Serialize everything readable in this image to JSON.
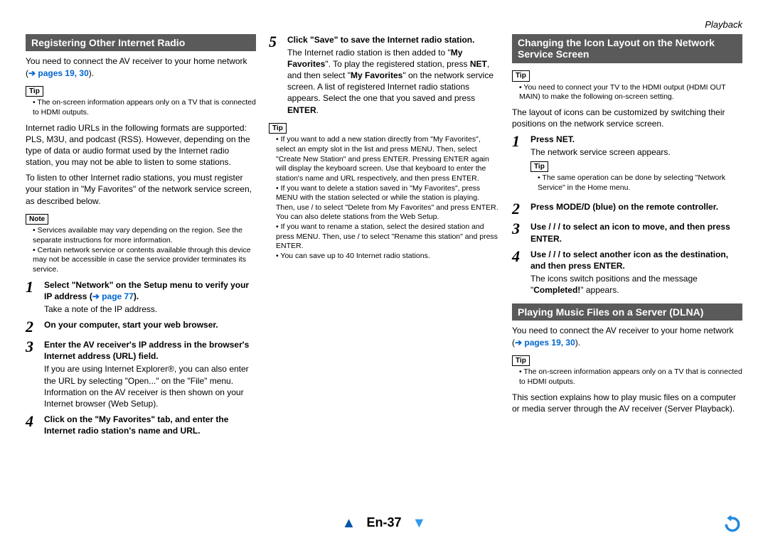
{
  "breadcrumb": "Playback",
  "page_number": "En-37",
  "col1": {
    "heading": "Registering Other Internet Radio",
    "intro_a": "You need to connect the AV receiver to your home network (",
    "intro_link": "➔ pages 19, 30",
    "intro_b": ").",
    "tip_label": "Tip",
    "tip1": "The on-screen information appears only on a TV that is connected to HDMI outputs.",
    "p2": "Internet radio URLs in the following formats are supported: PLS, M3U, and podcast (RSS). However, depending on the type of data or audio format used by the Internet radio station, you may not be able to listen to some stations.",
    "p3": "To listen to other Internet radio stations, you must register your station in \"My Favorites\" of the network service screen, as described below.",
    "note_label": "Note",
    "note1": "Services available may vary depending on the region. See the separate instructions for more information.",
    "note2": "Certain network service or contents available through this device may not be accessible in case the service provider terminates its service.",
    "steps": [
      {
        "n": "1",
        "title_a": "Select \"Network\" on the Setup menu to verify your IP address (",
        "title_link": "➔ page 77",
        "title_b": ").",
        "desc": "Take a note of the IP address."
      },
      {
        "n": "2",
        "title": "On your computer, start your web browser."
      },
      {
        "n": "3",
        "title": "Enter the AV receiver's IP address in the browser's Internet address (URL) field.",
        "desc": "If you are using Internet Explorer®, you can also enter the URL by selecting \"Open...\" on the \"File\" menu.\nInformation on the AV receiver is then shown on your Internet browser (Web Setup)."
      },
      {
        "n": "4",
        "title": "Click on the \"My Favorites\" tab, and enter the Internet radio station's name and URL."
      }
    ]
  },
  "col2": {
    "step5": {
      "n": "5",
      "title": "Click \"Save\" to save the Internet radio station.",
      "desc_a": "The Internet radio station is then added to \"",
      "desc_b": "My Favorites",
      "desc_c": "\". To play the registered station, press ",
      "desc_d": "NET",
      "desc_e": ", and then select \"",
      "desc_f": "My Favorites",
      "desc_g": "\" on the network service screen. A list of registered Internet radio stations appears. Select the one that you saved and press ",
      "desc_h": "ENTER",
      "desc_i": "."
    },
    "tip_label": "Tip",
    "tip_b1": "If you want to add a new station directly from \"My Favorites\", select an empty slot in the list and press MENU. Then, select \"Create New Station\" and press ENTER. Pressing ENTER again will display the keyboard screen. Use that keyboard to enter the station's name and URL respectively, and then press ENTER.",
    "tip_b2": "If you want to delete a station saved in \"My Favorites\", press MENU with the station selected or while the station is playing. Then, use  /  to select \"Delete from My Favorites\" and press ENTER. You can also delete stations from the Web Setup.",
    "tip_b3": "If you want to rename a station, select the desired station and press MENU. Then, use  /  to select \"Rename this station\" and press ENTER.",
    "tip_b4": "You can save up to 40 Internet radio stations."
  },
  "col3": {
    "heading1": "Changing the Icon Layout on the Network Service Screen",
    "tip_label": "Tip",
    "tip1": "You need to connect your TV to the HDMI output (HDMI OUT MAIN) to make the following on-screen setting.",
    "p1": "The layout of icons can be customized by switching their positions on the network service screen.",
    "steps": [
      {
        "n": "1",
        "title": "Press NET.",
        "desc": "The network service screen appears.",
        "tip_label": "Tip",
        "tip": "The same operation can be done by selecting \"Network Service\" in the Home menu."
      },
      {
        "n": "2",
        "title": "Press MODE/D (blue) on the remote controller."
      },
      {
        "n": "3",
        "title": "Use  /  /  /  to select an icon to move, and then press ENTER."
      },
      {
        "n": "4",
        "title": "Use  /  /  /  to select another icon as the destination, and then press ENTER.",
        "desc_a": "The icons switch positions and the message \"",
        "desc_b": "Completed!",
        "desc_c": "\" appears."
      }
    ],
    "heading2": "Playing Music Files on a Server (DLNA)",
    "p2_a": "You need to connect the AV receiver to your home network (",
    "p2_link": "➔ pages 19, 30",
    "p2_b": ").",
    "tip_label2": "Tip",
    "tip2": "The on-screen information appears only on a TV that is connected to HDMI outputs.",
    "p3": "This section explains how to play music files on a computer or media server through the AV receiver (Server Playback)."
  }
}
